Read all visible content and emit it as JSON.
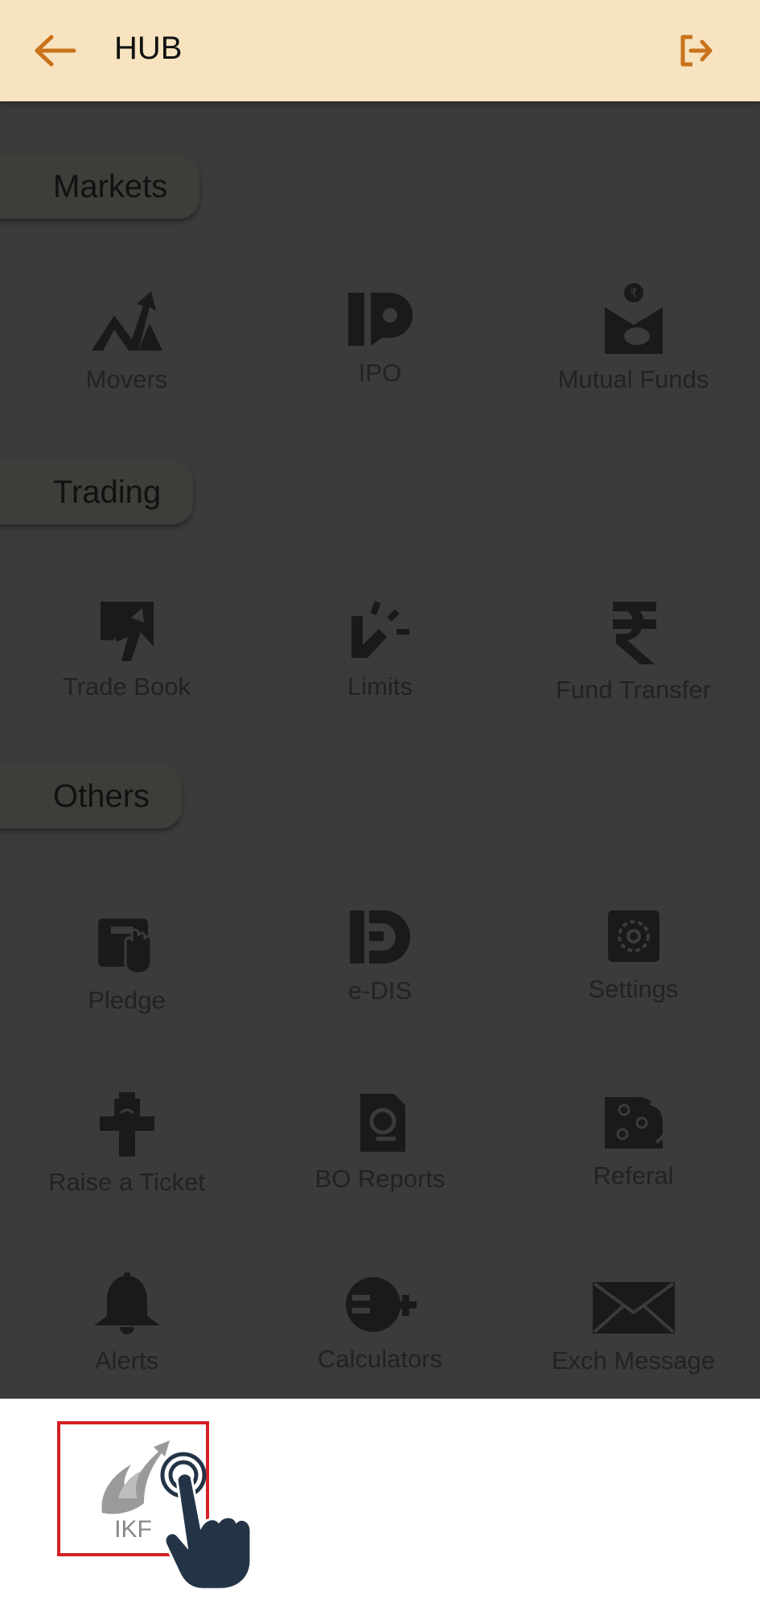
{
  "header": {
    "title": "HUB"
  },
  "sections": {
    "markets": "Markets",
    "trading": "Trading",
    "others": "Others"
  },
  "tiles": {
    "movers": "Movers",
    "ipo": "IPO",
    "mutual_funds": "Mutual Funds",
    "trade_book": "Trade Book",
    "limits": "Limits",
    "fund_transfer": "Fund Transfer",
    "pledge": "Pledge",
    "edis": "e-DIS",
    "settings": "Settings",
    "raise_ticket": "Raise a Ticket",
    "bo_reports": "BO Reports",
    "referal": "Referal",
    "alerts": "Alerts",
    "calculators": "Calculators",
    "exch_message": "Exch Message"
  },
  "bottom": {
    "ikf_label": "IKF"
  },
  "colors": {
    "header_bg": "#f7e3bf",
    "accent": "#c8731b",
    "overlay": "#3b3b3b",
    "highlight": "#d32026"
  }
}
